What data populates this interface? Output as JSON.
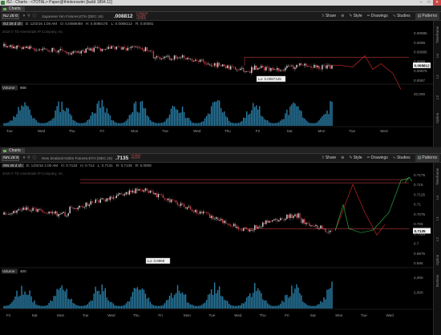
{
  "window": {
    "title": "/6J - Charts - <TOTAL> Paper@thinkorswim [build 1894.11]",
    "controls": [
      "–",
      "□",
      "✕"
    ]
  },
  "colors": {
    "up_bar": "#d8d8d8",
    "down_bar": "#c8404a",
    "level_line": "#e04a4a",
    "forecast_red": "#e02b2b",
    "forecast_green": "#2fbf4a",
    "volume_bar": "#2a7fa8",
    "header_bg": "#222222",
    "chart_bg": "#000000"
  },
  "panels": [
    {
      "id": "top",
      "tab_label": "Charts",
      "symbol": "/6J 28 d 1h",
      "description": "Japanese Yen Futures,ETH (DEC 16)",
      "last_price": ".008812",
      "change_lines": [
        "0.000019",
        "+0.22%",
        "+0.01%"
      ],
      "toolbar_buttons": [
        {
          "icon": "share-icon",
          "glyph": "⇧",
          "label": "Share"
        },
        {
          "icon": "zoom-icon",
          "glyph": "⊕",
          "label": ""
        },
        {
          "icon": "style-icon",
          "glyph": "✎",
          "label": "Style"
        },
        {
          "icon": "drawings-icon",
          "glyph": "✏",
          "label": "Drawings"
        },
        {
          "icon": "studies-icon",
          "glyph": "∿",
          "label": "Studies"
        },
        {
          "icon": "patterns-icon",
          "glyph": "▤",
          "label": "Patterns"
        }
      ],
      "ohlc": {
        "d": "D: 12/3/16 1:00 AM",
        "o": "O: 0.0088088",
        "h": "H: 0.0088175",
        "l": "L: 0.0088112",
        "r": "R: 0.00081"
      },
      "watermark": "2016 © TD Ameritrade IP Company, Inc.",
      "price_axis": [
        "0.00895",
        "0.0089",
        "0.00885",
        "0.0088",
        "0.00875",
        "0.0087"
      ],
      "price_tag": "0.008812",
      "lo_label": "Lo: 0.0087125",
      "volume_label": "Volume",
      "volume_value": "908",
      "volume_axis": [
        "20,000"
      ],
      "time_axis": [
        "Tue",
        "Wed",
        "Thu",
        "Fri",
        "Mon",
        "Tue",
        "Wed",
        "Thu",
        "Fri",
        "Sat",
        "Mon",
        "Tue",
        "Wed"
      ],
      "sidebar": [
        "Timeframe",
        "Ln",
        "L1",
        "L2",
        "Option"
      ]
    },
    {
      "id": "bottom",
      "tab_label": "Charts",
      "symbol": "/6N 28 d 1h",
      "description": "New Zealand Dollar Futures,ETH (DEC 16)",
      "last_price": ".7135",
      "change_lines": [
        "+0.0019",
        "+0.27%"
      ],
      "toolbar_buttons": [
        {
          "icon": "share-icon",
          "glyph": "⇧",
          "label": "Share"
        },
        {
          "icon": "zoom-icon",
          "glyph": "⊕",
          "label": ""
        },
        {
          "icon": "style-icon",
          "glyph": "✎",
          "label": "Style"
        },
        {
          "icon": "drawings-icon",
          "glyph": "✏",
          "label": "Drawings"
        },
        {
          "icon": "studies-icon",
          "glyph": "∿",
          "label": "Studies"
        },
        {
          "icon": "patterns-icon",
          "glyph": "▤",
          "label": "Patterns"
        }
      ],
      "ohlc": {
        "d": "D: 12/3/16 1:00 AM",
        "o": "O: 0.7133",
        "h": "H: 0.714",
        "l": "L: 0.7131",
        "r": "R: 0.7135",
        "extra": "R: 0.0009"
      },
      "watermark": "2016 © TD Ameritrade IP Company, Inc.",
      "price_axis": [
        "0.7175",
        "0.715",
        "0.7125",
        "0.71",
        "0.7075",
        "0.705",
        "0.7025",
        "0.7",
        "0.6975",
        "0.695"
      ],
      "price_tag": "0.7135",
      "lo_label": "Lo: 0.6966",
      "volume_label": "Volume",
      "volume_value": "400",
      "volume_axis": [
        "4,000",
        "2,000"
      ],
      "time_axis": [
        "Fri",
        "Sat",
        "Mon",
        "Tue",
        "Wed",
        "Thu",
        "Fri",
        "Mon",
        "Tue",
        "Wed",
        "Thu",
        "Fri",
        "Sat",
        "Mon",
        "Tue",
        "Wed"
      ],
      "sidebar": [
        "Timeframe",
        "Ln",
        "L1",
        "L2",
        "Option",
        "Buttons"
      ]
    }
  ]
}
